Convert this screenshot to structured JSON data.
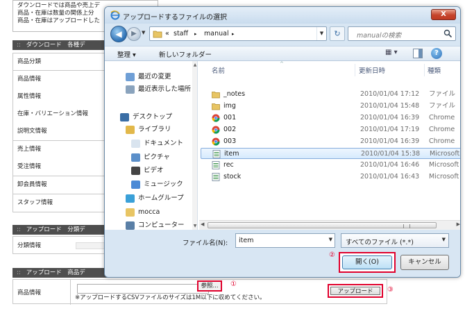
{
  "background": {
    "notice_lines": [
      "ダウンロードでは商品や売上デ",
      "商品・在庫は数量の関係上分",
      "商品・在庫はアップロードした"
    ],
    "section1_title": "ダウンロード　各種デ",
    "section1_rows": [
      "商品分類",
      "商品情報",
      "属性情報",
      "在庫・バリエーション情報",
      "説明文情報",
      "売上情報",
      "受注情報",
      "卸会員情報",
      "スタッフ情報"
    ],
    "section2_title": "アップロード　分類デ",
    "section2_rows": [
      "分類情報"
    ],
    "section3_title": "アップロード　商品デ",
    "section3_mark": "::",
    "product_label": "商品情報",
    "browse_label": "参照...",
    "note": "※アップロードするCSVファイルのサイズは1M以下に収めてください。",
    "upload_label": "アップロード",
    "callouts": [
      "①",
      "②",
      "③"
    ]
  },
  "dialog": {
    "title": "アップロードするファイルの選択",
    "close": "X",
    "address": {
      "prefix": "«",
      "segments": [
        "staff",
        "manual"
      ],
      "sep": "▸"
    },
    "search_placeholder": "manualの検索",
    "toolbar": {
      "organize": "整理 ▾",
      "new_folder": "新しいフォルダー",
      "view": "▦ ▾",
      "help": "?"
    },
    "nav_items": [
      {
        "label": "最近の変更",
        "icon": "recent-icon"
      },
      {
        "label": "最近表示した場所",
        "icon": "places-icon"
      },
      {
        "label": "デスクトップ",
        "icon": "desktop-icon"
      },
      {
        "label": "ライブラリ",
        "icon": "library-icon"
      },
      {
        "label": "ドキュメント",
        "icon": "document-icon"
      },
      {
        "label": "ピクチャ",
        "icon": "picture-icon"
      },
      {
        "label": "ビデオ",
        "icon": "video-icon"
      },
      {
        "label": "ミュージック",
        "icon": "music-icon"
      },
      {
        "label": "ホームグループ",
        "icon": "homegroup-icon"
      },
      {
        "label": "mocca",
        "icon": "user-folder-icon"
      },
      {
        "label": "コンピューター",
        "icon": "computer-icon"
      }
    ],
    "columns": {
      "name": "名前",
      "date": "更新日時",
      "type": "種類"
    },
    "files": [
      {
        "name": "_notes",
        "date": "2010/01/04 17:12",
        "type": "ファイル",
        "kind": "folder"
      },
      {
        "name": "img",
        "date": "2010/01/04 15:48",
        "type": "ファイル",
        "kind": "folder"
      },
      {
        "name": "001",
        "date": "2010/01/04 16:39",
        "type": "Chrome",
        "kind": "chrome"
      },
      {
        "name": "002",
        "date": "2010/01/04 17:19",
        "type": "Chrome",
        "kind": "chrome"
      },
      {
        "name": "003",
        "date": "2010/01/04 16:39",
        "type": "Chrome",
        "kind": "chrome"
      },
      {
        "name": "item",
        "date": "2010/01/04 15:38",
        "type": "Microsoft",
        "kind": "csv"
      },
      {
        "name": "rec",
        "date": "2010/01/04 16:46",
        "type": "Microsoft",
        "kind": "csv"
      },
      {
        "name": "stock",
        "date": "2010/01/04 16:43",
        "type": "Microsoft",
        "kind": "csv"
      }
    ],
    "selected_file": "item",
    "filename_label": "ファイル名(N):",
    "filename_value": "item",
    "filetype_value": "すべてのファイル (*.*)",
    "open_label": "開く(O)",
    "cancel_label": "キャンセル"
  },
  "colors": {
    "accent_red": "#e0002c",
    "selection": "#d6eafd"
  }
}
